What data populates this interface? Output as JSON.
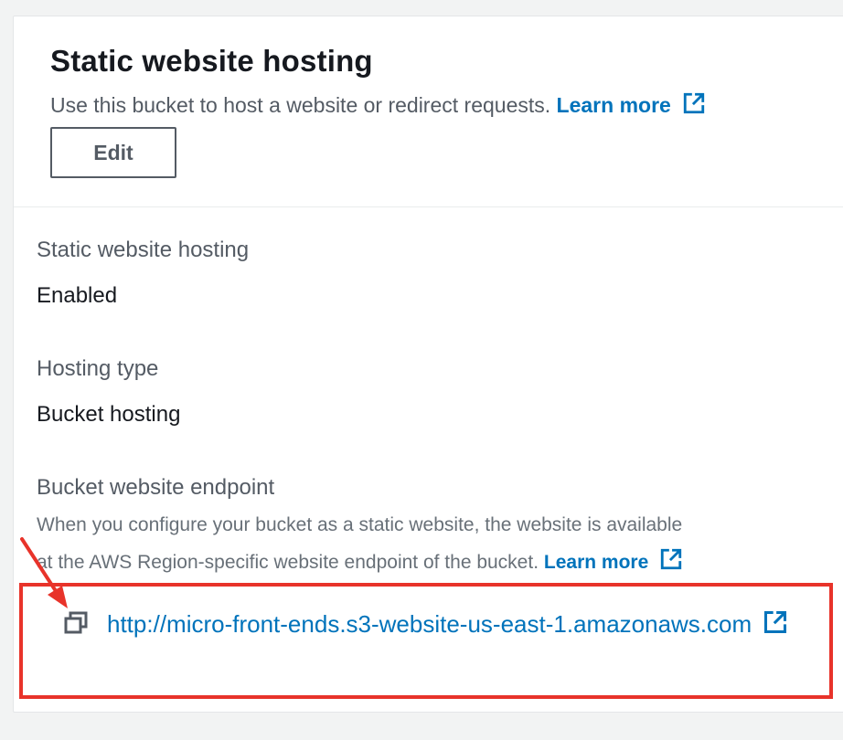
{
  "header": {
    "title": "Static website hosting",
    "description": "Use this bucket to host a website or redirect requests.",
    "learn_more": "Learn more",
    "edit_label": "Edit"
  },
  "properties": {
    "hosting": {
      "label": "Static website hosting",
      "value": "Enabled"
    },
    "hosting_type": {
      "label": "Hosting type",
      "value": "Bucket hosting"
    },
    "endpoint": {
      "label": "Bucket website endpoint",
      "help_line1": "When you configure your bucket as a static website, the website is available",
      "help_line2": "at the AWS Region-specific website endpoint of the bucket.",
      "learn_more": "Learn more",
      "url": "http://micro-front-ends.s3-website-us-east-1.amazonaws.com"
    }
  },
  "icons": {
    "external_link": "external-link-icon",
    "copy": "copy-icon",
    "annotation_arrow": "annotation-arrow"
  },
  "colors": {
    "link": "#0073bb",
    "title": "#16191f",
    "secondary_text": "#545b64",
    "annotation": "#e8332a"
  }
}
